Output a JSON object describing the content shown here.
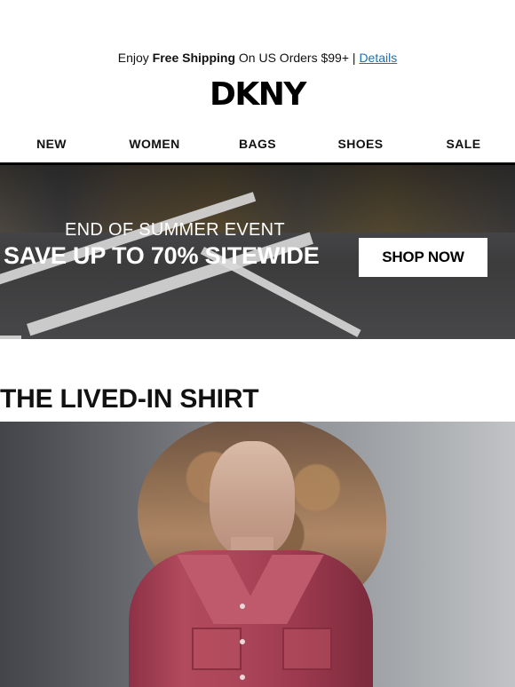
{
  "header": {
    "shipping": {
      "prefix": "Enjoy ",
      "highlight": "Free Shipping",
      "suffix": " On US Orders $99+ | ",
      "details_label": "Details"
    },
    "logo": "DKNY"
  },
  "nav": {
    "items": [
      {
        "label": "NEW"
      },
      {
        "label": "WOMEN"
      },
      {
        "label": "BAGS"
      },
      {
        "label": "SHOES"
      },
      {
        "label": "SALE"
      }
    ]
  },
  "hero": {
    "kicker": "END OF SUMMER EVENT",
    "headline": "SAVE UP TO 70% SITEWIDE",
    "button_label": "SHOP NOW"
  },
  "section": {
    "title": "THE LIVED-IN SHIRT"
  }
}
